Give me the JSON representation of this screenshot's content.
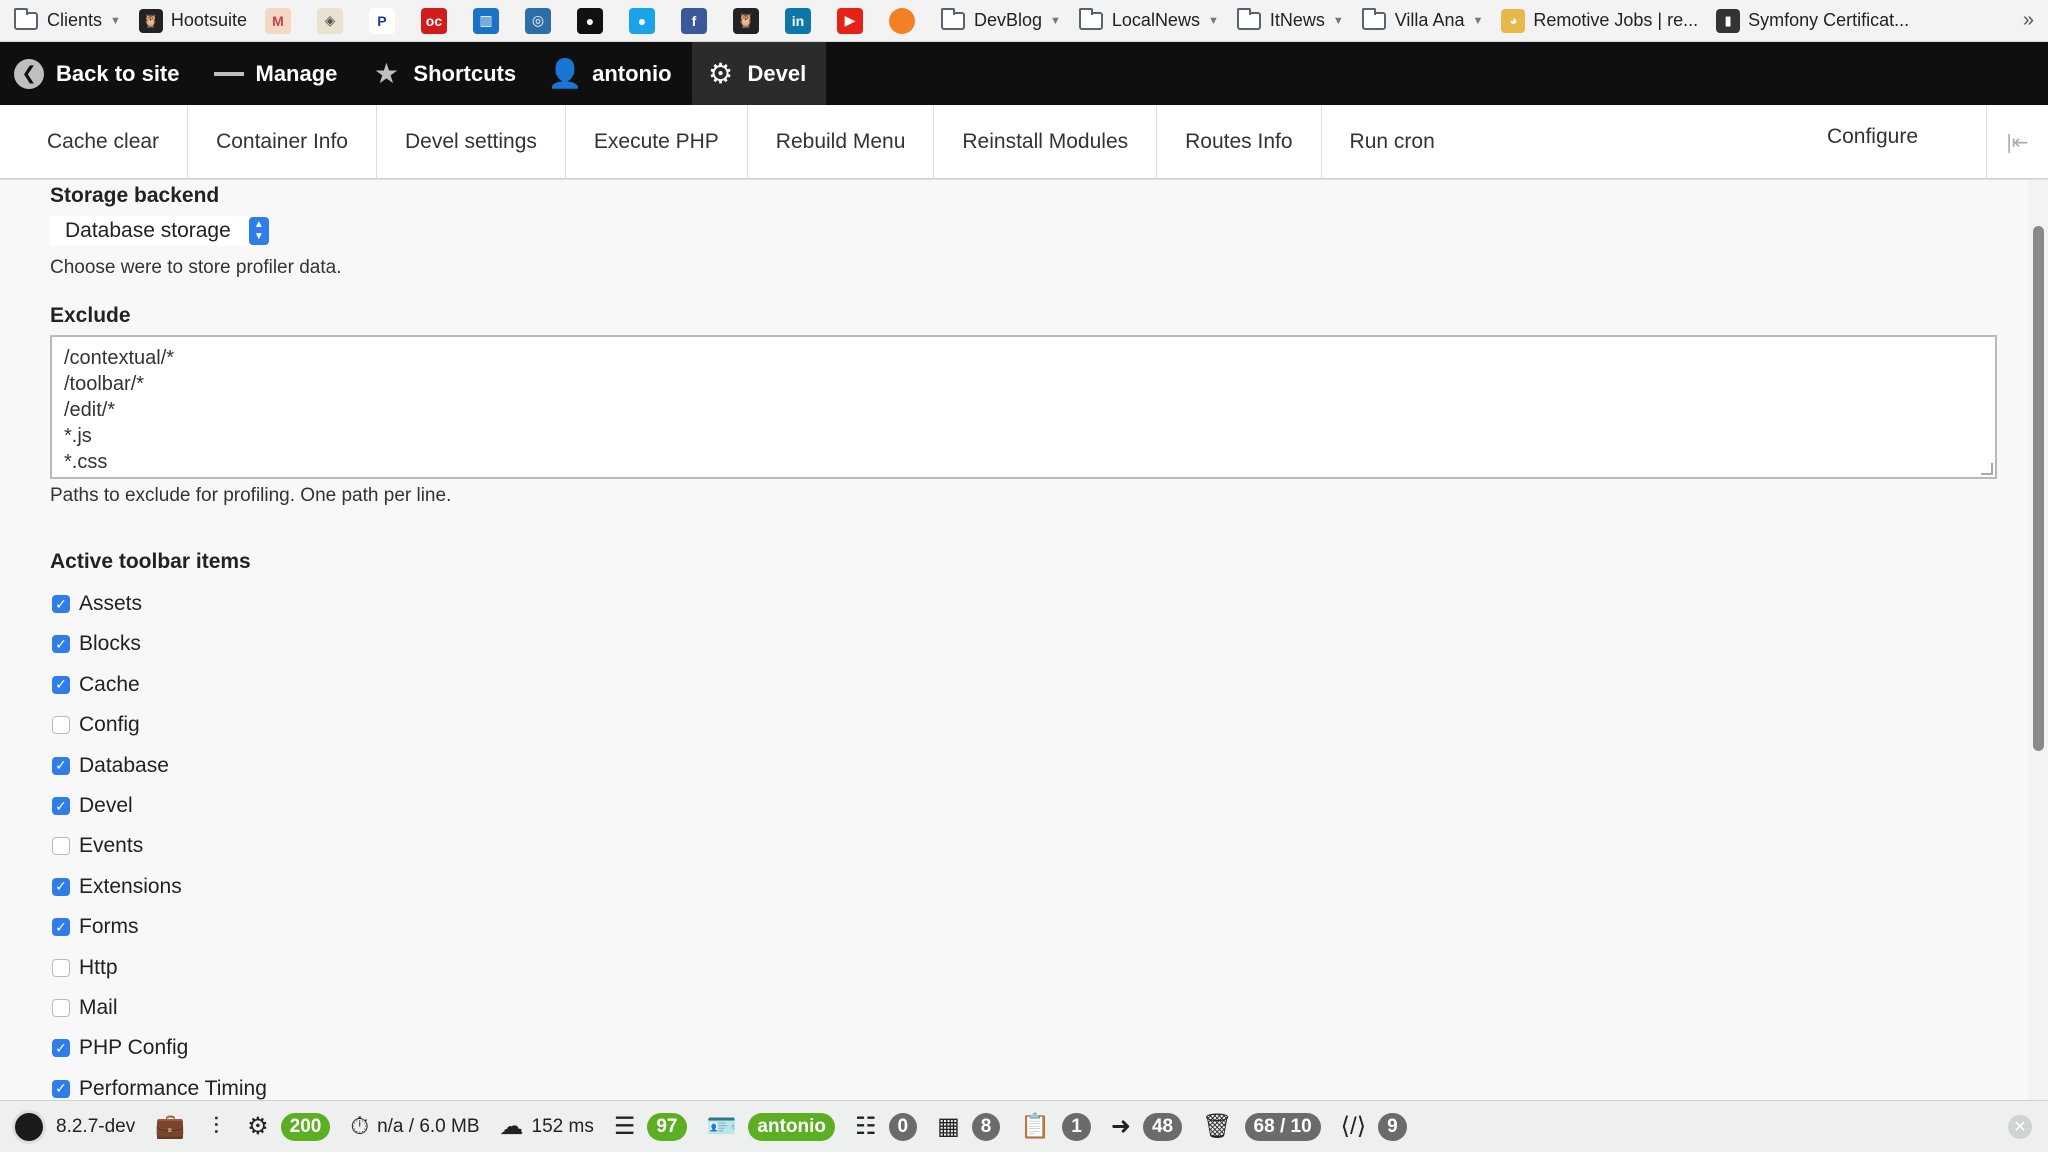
{
  "bookmarks": {
    "folders_and_links": [
      {
        "label": "Clients",
        "type": "folder"
      },
      {
        "label": "Hootsuite",
        "type": "link",
        "icon": "owl-icon"
      },
      {
        "label": "DevBlog",
        "type": "folder"
      },
      {
        "label": "LocalNews",
        "type": "folder"
      },
      {
        "label": "ItNews",
        "type": "folder"
      },
      {
        "label": "Villa Ana",
        "type": "folder"
      },
      {
        "label": "Remotive Jobs | re...",
        "type": "link"
      },
      {
        "label": "Symfony Certificat...",
        "type": "link"
      }
    ],
    "more": "»"
  },
  "admin_toolbar": {
    "back": "Back to site",
    "manage": "Manage",
    "shortcuts": "Shortcuts",
    "user": "antonio",
    "devel": "Devel"
  },
  "devel_tray": {
    "links": [
      "Cache clear",
      "Container Info",
      "Devel settings",
      "Execute PHP",
      "Rebuild Menu",
      "Reinstall Modules",
      "Routes Info",
      "Run cron"
    ],
    "configure": "Configure"
  },
  "form": {
    "storage_label": "Storage backend",
    "storage_value": "Database storage",
    "storage_desc": "Choose were to store profiler data.",
    "exclude_label": "Exclude",
    "exclude_lines": [
      "/contextual/*",
      "/toolbar/*",
      "/edit/*",
      "*.js",
      "*.css"
    ],
    "exclude_desc": "Paths to exclude for profiling. One path per line.",
    "toolbar_items_label": "Active toolbar items",
    "toolbar_items": [
      {
        "label": "Assets",
        "checked": true
      },
      {
        "label": "Blocks",
        "checked": true
      },
      {
        "label": "Cache",
        "checked": true
      },
      {
        "label": "Config",
        "checked": false
      },
      {
        "label": "Database",
        "checked": true
      },
      {
        "label": "Devel",
        "checked": true
      },
      {
        "label": "Events",
        "checked": false
      },
      {
        "label": "Extensions",
        "checked": true
      },
      {
        "label": "Forms",
        "checked": true
      },
      {
        "label": "Http",
        "checked": false
      },
      {
        "label": "Mail",
        "checked": false
      },
      {
        "label": "PHP Config",
        "checked": true
      },
      {
        "label": "Performance Timing",
        "checked": true
      }
    ]
  },
  "profiler_bar": {
    "php_version": "8.2.7-dev",
    "status": "200",
    "memory": "n/a / 6.0 MB",
    "time": "152 ms",
    "db_queries": "97",
    "user": "antonio",
    "count_a": "0",
    "count_b": "8",
    "count_c": "1",
    "count_d": "48",
    "cache_ratio": "68 / 10",
    "count_e": "9"
  },
  "colors": {
    "accent_blue": "#2f7de8",
    "badge_green": "#5cae22",
    "toolbar_black": "#0f0f0f"
  }
}
